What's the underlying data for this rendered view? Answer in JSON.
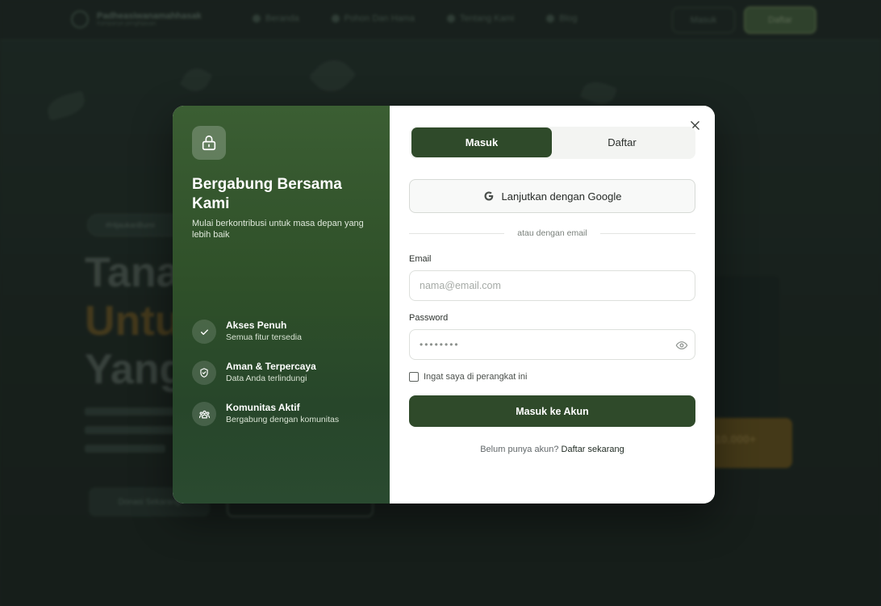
{
  "background": {
    "brand": {
      "name": "Padheasiwanamahhasak",
      "tagline": "Kampanye penghijauan"
    },
    "nav_links": [
      {
        "label": "Beranda"
      },
      {
        "label": "Pohon Dan Hama"
      },
      {
        "label": "Tentang Kami"
      },
      {
        "label": "Blog"
      }
    ],
    "login_label": "Masuk",
    "register_label": "Daftar",
    "pill_label": "#HijaukanBumi",
    "hero": {
      "line1": "Tana",
      "line2": "Untu",
      "line3": "Yang"
    },
    "cta_primary": "Donasi Sekarang",
    "stat": "10.000+"
  },
  "modal": {
    "left": {
      "title": "Bergabung Bersama Kami",
      "subtitle": "Mulai berkontribusi untuk masa depan yang lebih baik",
      "features": [
        {
          "title": "Akses Penuh",
          "desc": "Semua fitur tersedia",
          "icon": "check-icon"
        },
        {
          "title": "Aman & Terpercaya",
          "desc": "Data Anda terlindungi",
          "icon": "shield-check-icon"
        },
        {
          "title": "Komunitas Aktif",
          "desc": "Bergabung dengan komunitas",
          "icon": "community-icon"
        }
      ]
    },
    "tabs": {
      "login": "Masuk",
      "register": "Daftar",
      "active": "login"
    },
    "google_label": "Lanjutkan dengan Google",
    "divider": "atau dengan email",
    "email": {
      "label": "Email",
      "placeholder": "nama@email.com",
      "value": ""
    },
    "password": {
      "label": "Password",
      "value": "••••••••"
    },
    "remember_label": "Ingat saya di perangkat ini",
    "submit_label": "Masuk ke Akun",
    "footer": {
      "prompt": "Belum punya akun?",
      "link": "Daftar sekarang"
    }
  },
  "colors": {
    "primary": "#2f4a2a",
    "panel": "#2f5029",
    "accent": "#e8a33c"
  }
}
